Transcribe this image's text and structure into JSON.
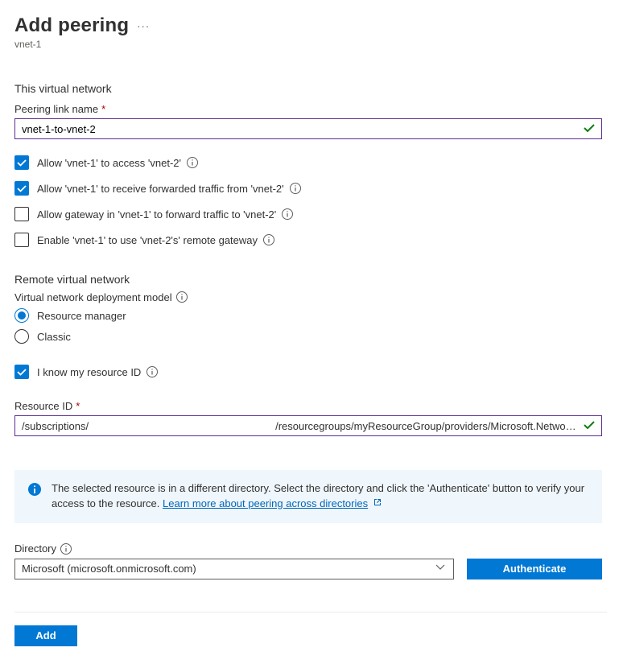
{
  "header": {
    "title": "Add peering",
    "subtitle": "vnet-1"
  },
  "section1": {
    "heading": "This virtual network",
    "linkNameLabel": "Peering link name",
    "linkNameValue": "vnet-1-to-vnet-2",
    "cb1": "Allow 'vnet-1' to access 'vnet-2'",
    "cb2": "Allow 'vnet-1' to receive forwarded traffic from 'vnet-2'",
    "cb3": "Allow gateway in 'vnet-1' to forward traffic to 'vnet-2'",
    "cb4": "Enable 'vnet-1' to use 'vnet-2's' remote gateway"
  },
  "section2": {
    "heading": "Remote virtual network",
    "deployLabel": "Virtual network deployment model",
    "opt1": "Resource manager",
    "opt2": "Classic",
    "knowId": "I know my resource ID",
    "ridLabel": "Resource ID",
    "ridLeft": "/subscriptions/",
    "ridRight": "/resourcegroups/myResourceGroup/providers/Microsoft.Netwo…"
  },
  "callout": {
    "text": "The selected resource is in a different directory. Select the directory and click the 'Authenticate' button to verify your access to the resource.",
    "link": "Learn more about peering across directories"
  },
  "directory": {
    "label": "Directory",
    "value": "Microsoft (microsoft.onmicrosoft.com)",
    "auth": "Authenticate"
  },
  "footer": {
    "add": "Add"
  }
}
